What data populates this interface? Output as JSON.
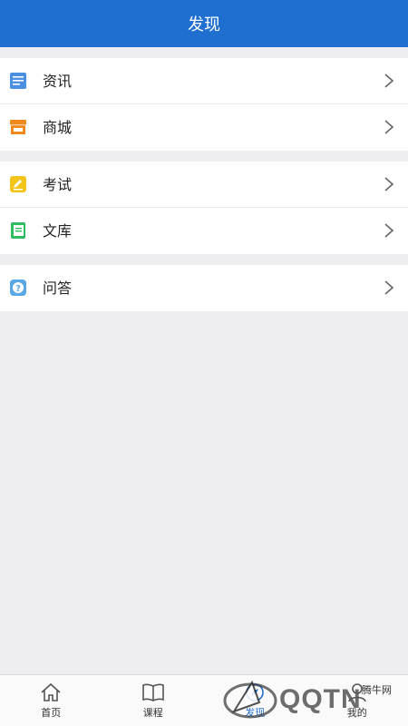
{
  "header": {
    "title": "发现"
  },
  "groups": [
    {
      "items": [
        {
          "label": "资讯",
          "icon": "news-icon",
          "color": "#4a8fe0"
        },
        {
          "label": "商城",
          "icon": "store-icon",
          "color": "#f08a1c"
        }
      ]
    },
    {
      "items": [
        {
          "label": "考试",
          "icon": "exam-pencil-icon",
          "color": "#f3c51a"
        },
        {
          "label": "文库",
          "icon": "library-book-icon",
          "color": "#2ebd63"
        }
      ]
    },
    {
      "items": [
        {
          "label": "问答",
          "icon": "question-icon",
          "color": "#5aa7e6"
        }
      ]
    }
  ],
  "tabbar": {
    "tabs": [
      {
        "label": "首页",
        "icon": "home-icon"
      },
      {
        "label": "课程",
        "icon": "book-open-icon"
      },
      {
        "label": "发现",
        "icon": "discover-icon",
        "active": true
      },
      {
        "label": "我的",
        "icon": "user-icon"
      }
    ]
  },
  "watermark": {
    "text": "QQTN",
    "small": "腾牛网"
  }
}
